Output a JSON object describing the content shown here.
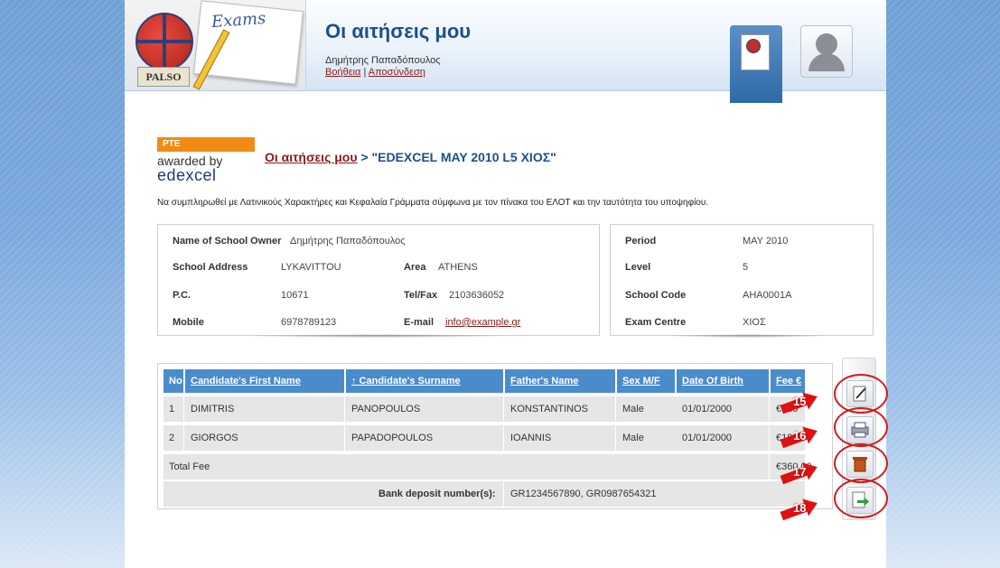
{
  "header": {
    "title": "Οι αιτήσεις μου",
    "user_name": "Δημήτρης Παπαδόπουλος",
    "help_link": "Βοήθεια",
    "separator": "|",
    "logout_link": "Αποσύνδεση",
    "logo_text": "PALSO",
    "logo_exams": "Exams"
  },
  "brand": {
    "pte": "PTE",
    "awarded": "awarded by",
    "edexcel": "edexcel"
  },
  "breadcrumb": {
    "link": "Οι αιτήσεις μου",
    "rest": " > \"EDEXCEL MAY 2010 L5 ΧΙΟΣ\""
  },
  "note": "Να συμπληρωθεί με Λατινικούς Χαρακτήρες και Κεφαλαία Γράμματα σύμφωνα με τον πίνακα του ΕΛΟΤ και την ταυτότητα του υποψηφίου.",
  "school": {
    "owner_label": "Name of School Owner",
    "owner_value": "Δημήτρης Παπαδόπουλος",
    "address_label": "School Address",
    "address_value": "LYKAVITTOU",
    "area_label": "Area",
    "area_value": "ATHENS",
    "pc_label": "P.C.",
    "pc_value": "10671",
    "telfax_label": "Tel/Fax",
    "telfax_value": "2103636052",
    "mobile_label": "Mobile",
    "mobile_value": "6978789123",
    "email_label": "E-mail",
    "email_value": "info@example.gr"
  },
  "exam": {
    "period_label": "Period",
    "period_value": "MAY 2010",
    "level_label": "Level",
    "level_value": "5",
    "code_label": "School Code",
    "code_value": "AHA0001A",
    "centre_label": "Exam Centre",
    "centre_value": "ΧΙΟΣ"
  },
  "table": {
    "headers": [
      "No",
      "Candidate's First Name",
      "↑ Candidate's Surname",
      "Father's Name",
      "Sex M/F",
      "Date Of Birth",
      "Fee €"
    ],
    "rows": [
      [
        "1",
        "DIMITRIS",
        "PANOPOULOS",
        "KONSTANTINOS",
        "Male",
        "01/01/2000",
        "€180"
      ],
      [
        "2",
        "GIORGOS",
        "PAPADOPOULOS",
        "IOANNIS",
        "Male",
        "01/01/2000",
        "€180"
      ]
    ],
    "total_label": "Total Fee",
    "total_value": "€360,00",
    "deposit_label": "Bank deposit number(s):",
    "deposit_value": "GR1234567890, GR0987654321"
  },
  "annotations": [
    "15",
    "16",
    "17",
    "18"
  ],
  "colors": {
    "header_title": "#1d4f8c",
    "table_header": "#4a8ccb",
    "link": "#8a1a1a",
    "annotation_red": "#e11010"
  }
}
